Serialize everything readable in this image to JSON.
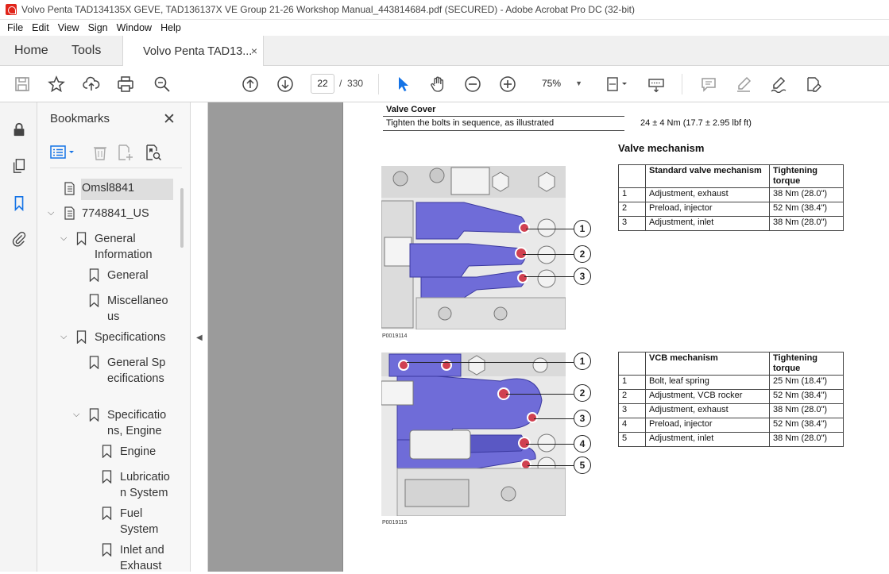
{
  "window": {
    "title": "Volvo Penta TAD134135X GEVE, TAD136137X VE Group 21-26 Workshop Manual_443814684.pdf (SECURED) - Adobe Acrobat Pro DC (32-bit)"
  },
  "menu": [
    "File",
    "Edit",
    "View",
    "Sign",
    "Window",
    "Help"
  ],
  "tabs": {
    "home": "Home",
    "tools": "Tools",
    "doc": "Volvo Penta TAD13...",
    "close": "×"
  },
  "toolbar": {
    "page_current": "22",
    "page_sep": "/",
    "page_total": "330",
    "zoom": "75%"
  },
  "bookmarks": {
    "title": "Bookmarks",
    "close": "✕",
    "items": [
      {
        "label": "Omsl8841"
      },
      {
        "label": "7748841_US"
      },
      {
        "label": "General Information"
      },
      {
        "label": "General"
      },
      {
        "label": "Miscellaneous"
      },
      {
        "label": "Specifications"
      },
      {
        "label": "General Specifications"
      },
      {
        "label": "Specifications, Engine"
      },
      {
        "label": "Engine"
      },
      {
        "label": "Lubrication System"
      },
      {
        "label": "Fuel System"
      },
      {
        "label": "Inlet and Exhaust"
      }
    ]
  },
  "doc": {
    "valve_cover": {
      "heading": "Valve Cover",
      "text": "Tighten the bolts in sequence, as illustrated",
      "torque": "24 ± 4 Nm (17.7 ± 2.95 lbf ft)"
    },
    "section_title": "Valve mechanism",
    "table1": {
      "headers": [
        "",
        "Standard valve mechanism",
        "Tightening torque"
      ],
      "rows": [
        [
          "1",
          "Adjustment, exhaust",
          "38 Nm (28.0\")"
        ],
        [
          "2",
          "Preload, injector",
          "52 Nm (38.4\")"
        ],
        [
          "3",
          "Adjustment, inlet",
          "38 Nm (28.0\")"
        ]
      ]
    },
    "table2": {
      "headers": [
        "",
        "VCB mechanism",
        "Tightening torque"
      ],
      "rows": [
        [
          "1",
          "Bolt, leaf spring",
          "25 Nm (18.4\")"
        ],
        [
          "2",
          "Adjustment, VCB rocker",
          "52 Nm (38.4\")"
        ],
        [
          "3",
          "Adjustment, exhaust",
          "38 Nm (28.0\")"
        ],
        [
          "4",
          "Preload, injector",
          "52 Nm (38.4\")"
        ],
        [
          "5",
          "Adjustment, inlet",
          "38 Nm (28.0\")"
        ]
      ]
    },
    "fig1": {
      "label": "P0019114",
      "callouts": [
        "1",
        "2",
        "3"
      ]
    },
    "fig2": {
      "label": "P0019115",
      "callouts": [
        "1",
        "2",
        "3",
        "4",
        "5"
      ]
    }
  }
}
